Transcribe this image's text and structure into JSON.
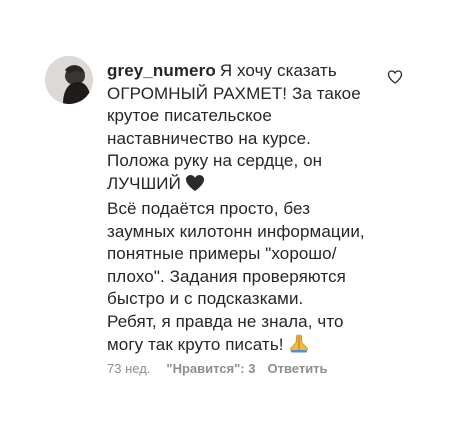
{
  "comment": {
    "username": "grey_numero",
    "lines": [
      "Я хочу сказать",
      "ОГРОМНЫЙ РАХМЕТ! За такое",
      "крутое писательское",
      "наставничество на курсе.",
      "Положа руку на сердце, он",
      "ЛУЧШИЙ",
      "Всё подаётся просто, без",
      "заумных килотонн информации,",
      "понятные примеры \"хорошо/",
      "плохо\". Задания проверяются",
      "быстро и с подсказками.",
      "Ребят, я правда не знала, что",
      "могу так круто писать!"
    ],
    "emojis": [
      "black-heart-icon",
      "folded-hands-icon"
    ],
    "time": "73 нед.",
    "likes": "\"Нравится\": 3",
    "reply": "Ответить",
    "colors": {
      "text": "#262626",
      "meta": "#8e8e8e"
    }
  }
}
